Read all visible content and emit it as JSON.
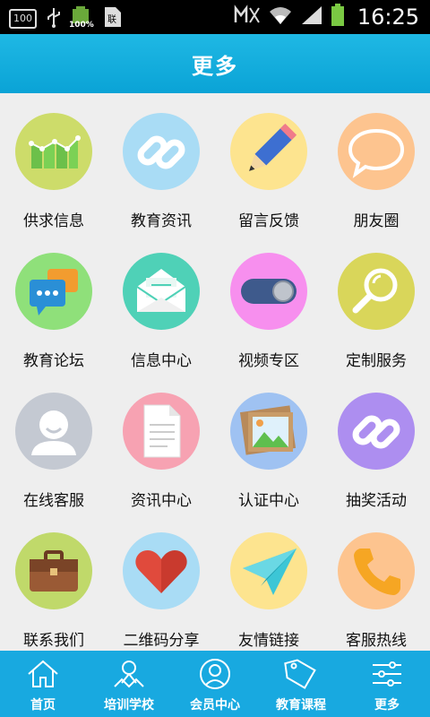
{
  "status": {
    "battery_badge": "100",
    "battery_pct": "100%",
    "time": "16:25"
  },
  "header": {
    "title": "更多"
  },
  "items": [
    {
      "label": "供求信息",
      "icon": "bar-chart-icon",
      "color": "#cddc6a"
    },
    {
      "label": "教育资讯",
      "icon": "link-icon",
      "color": "#a9dcf5"
    },
    {
      "label": "留言反馈",
      "icon": "pencil-icon",
      "color": "#fde48f"
    },
    {
      "label": "朋友圈",
      "icon": "speech-bubble-icon",
      "color": "#fdc48f"
    },
    {
      "label": "教育论坛",
      "icon": "chat-bubbles-icon",
      "color": "#8fe07a"
    },
    {
      "label": "信息中心",
      "icon": "envelope-icon",
      "color": "#4fd1b7"
    },
    {
      "label": "视频专区",
      "icon": "toggle-icon",
      "color": "#f78fee"
    },
    {
      "label": "定制服务",
      "icon": "magnifier-icon",
      "color": "#d9d65a"
    },
    {
      "label": "在线客服",
      "icon": "user-icon",
      "color": "#c4c9d2"
    },
    {
      "label": "资讯中心",
      "icon": "document-icon",
      "color": "#f7a2b2"
    },
    {
      "label": "认证中心",
      "icon": "picture-icon",
      "color": "#9fc2f2"
    },
    {
      "label": "抽奖活动",
      "icon": "link-icon",
      "color": "#ad8ef0"
    },
    {
      "label": "联系我们",
      "icon": "briefcase-icon",
      "color": "#c0d96a"
    },
    {
      "label": "二维码分享",
      "icon": "heart-icon",
      "color": "#a9dcf5"
    },
    {
      "label": "友情链接",
      "icon": "paper-plane-icon",
      "color": "#fde48f"
    },
    {
      "label": "客服热线",
      "icon": "phone-icon",
      "color": "#fdc48f"
    }
  ],
  "tabs": [
    {
      "label": "首页",
      "icon": "home-icon"
    },
    {
      "label": "培训学校",
      "icon": "map-pin-icon"
    },
    {
      "label": "会员中心",
      "icon": "member-icon"
    },
    {
      "label": "教育课程",
      "icon": "sale-tag-icon"
    },
    {
      "label": "更多",
      "icon": "sliders-icon"
    }
  ]
}
